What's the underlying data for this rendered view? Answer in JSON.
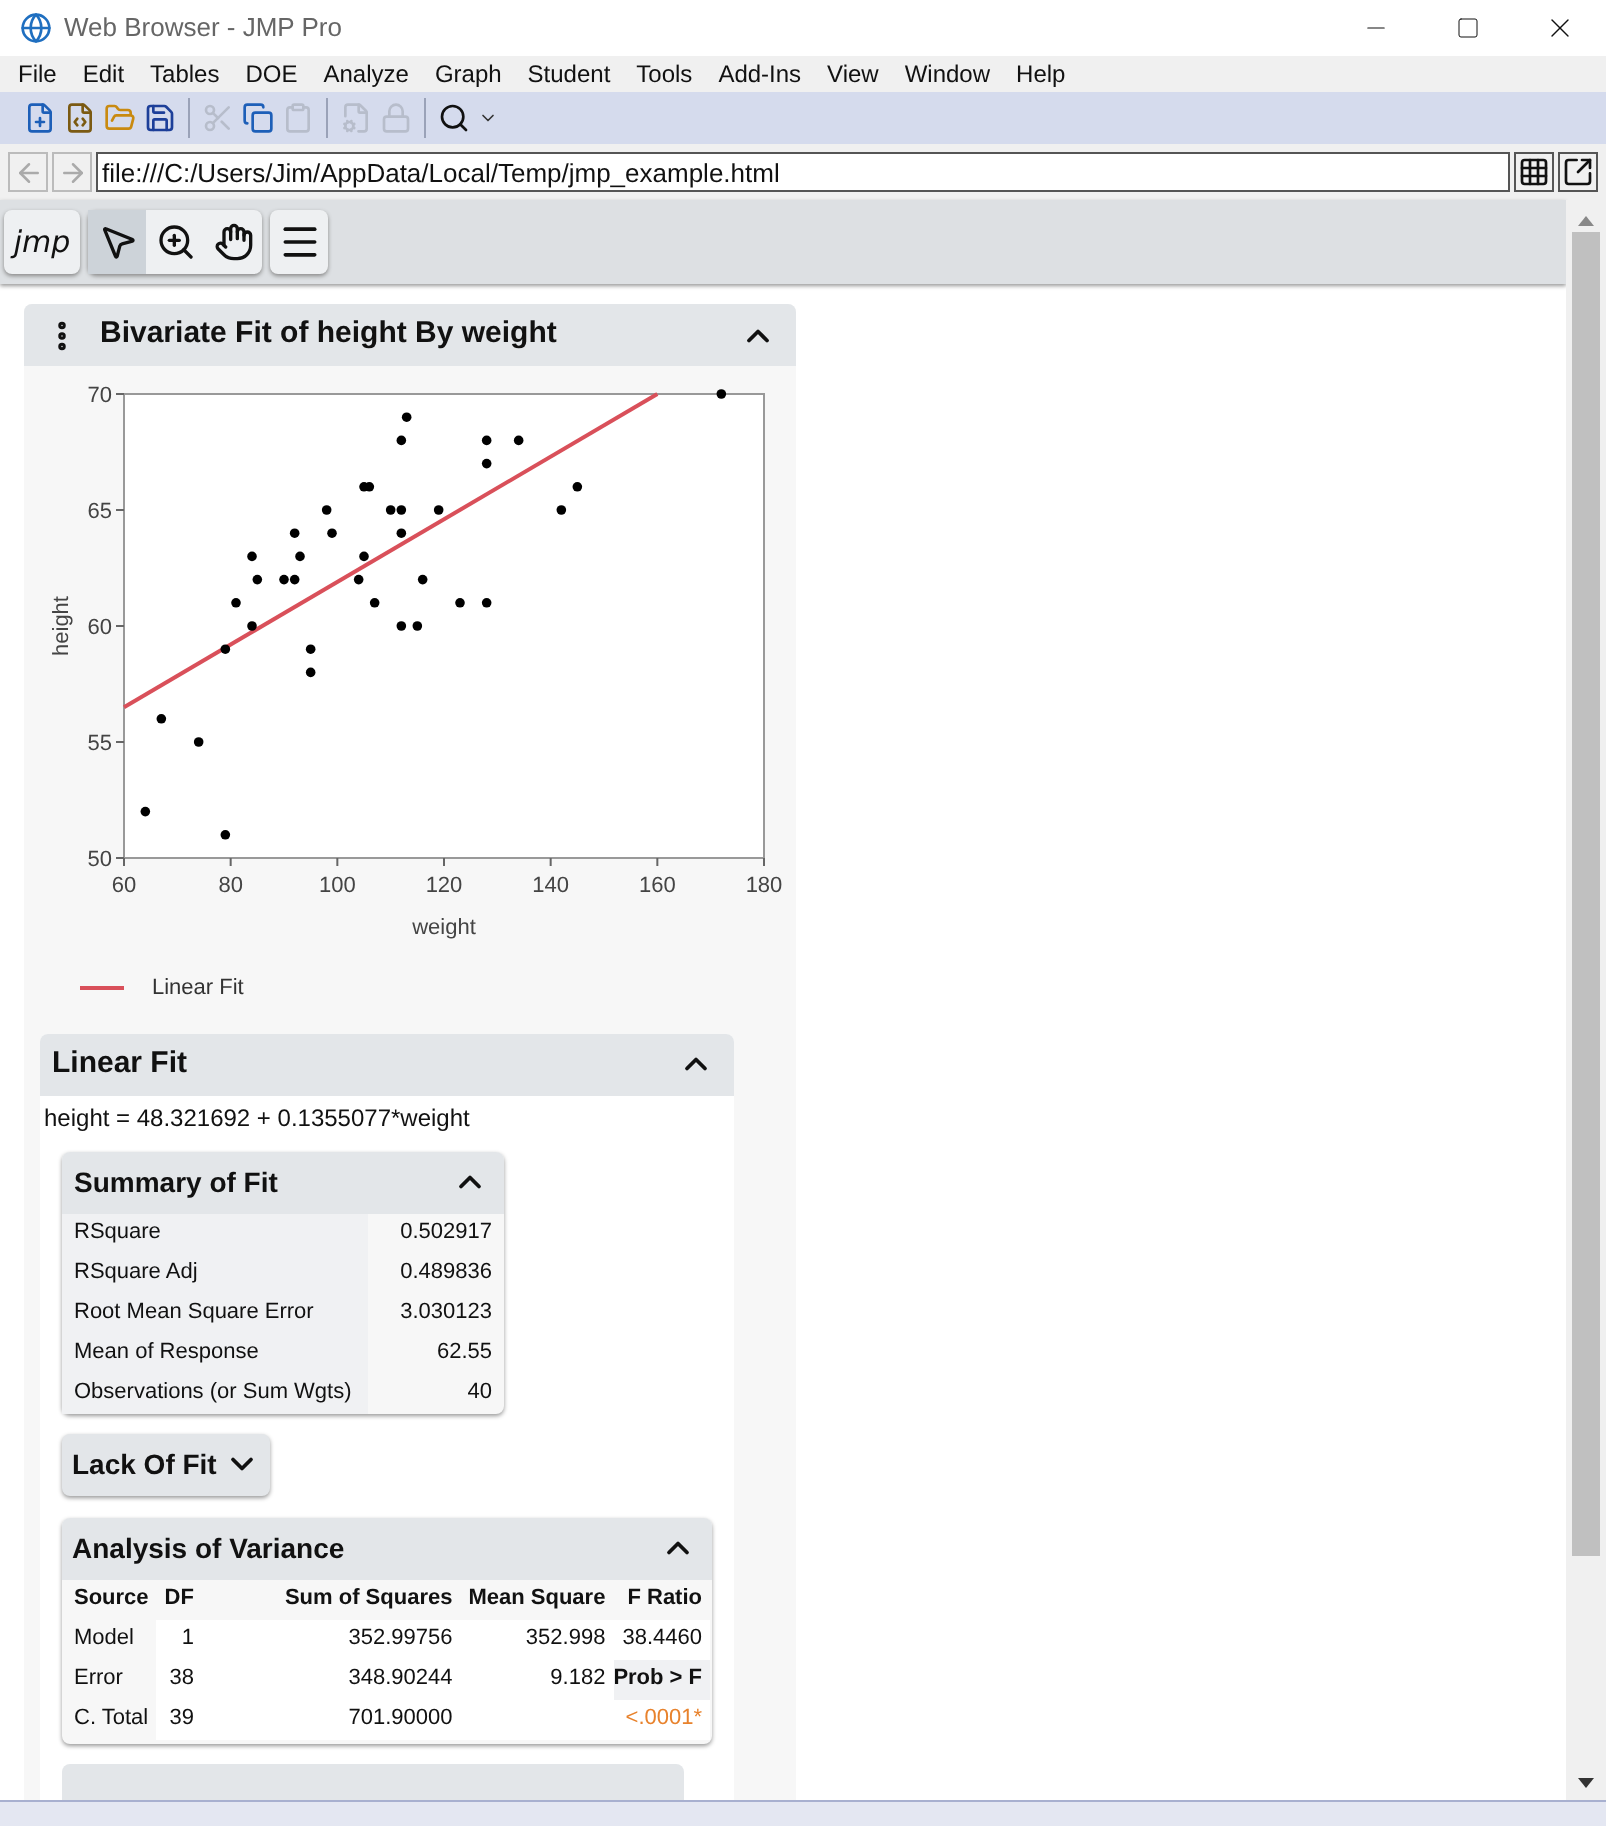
{
  "window": {
    "title": "Web Browser - JMP Pro"
  },
  "menu": [
    "File",
    "Edit",
    "Tables",
    "DOE",
    "Analyze",
    "Graph",
    "Student",
    "Tools",
    "Add-Ins",
    "View",
    "Window",
    "Help"
  ],
  "toolbar": [
    {
      "kind": "new-table",
      "disabled": false
    },
    {
      "kind": "new-script",
      "disabled": false
    },
    {
      "kind": "open",
      "disabled": false
    },
    {
      "kind": "save",
      "disabled": false
    },
    {
      "kind": "separator"
    },
    {
      "kind": "cut",
      "disabled": true
    },
    {
      "kind": "copy",
      "disabled": false
    },
    {
      "kind": "paste",
      "disabled": true
    },
    {
      "kind": "separator"
    },
    {
      "kind": "script",
      "disabled": true
    },
    {
      "kind": "lock",
      "disabled": true
    },
    {
      "kind": "separator"
    },
    {
      "kind": "search",
      "disabled": false
    },
    {
      "kind": "more",
      "disabled": false
    }
  ],
  "address": {
    "back_disabled": true,
    "forward_disabled": true,
    "value": "file:///C:/Users/Jim/AppData/Local/Temp/jmp_example.html"
  },
  "jmp_toolbar": {
    "logo": "jmp",
    "tools": [
      {
        "kind": "select",
        "selected": true
      },
      {
        "kind": "zoom",
        "selected": false
      },
      {
        "kind": "hand",
        "selected": false
      }
    ]
  },
  "report": {
    "title": "Bivariate Fit of height By weight",
    "expanded": true,
    "chart_data": {
      "type": "scatter",
      "xlabel": "weight",
      "ylabel": "height",
      "xlim": [
        60,
        180
      ],
      "ylim": [
        50,
        70
      ],
      "xticks": [
        60,
        80,
        100,
        120,
        140,
        160,
        180
      ],
      "yticks": [
        50,
        55,
        60,
        65,
        70
      ],
      "series": [
        {
          "type": "scatter",
          "color": "#000000",
          "x": [
            64,
            67,
            74,
            79,
            79,
            81,
            84,
            84,
            85,
            90,
            92,
            92,
            93,
            95,
            95,
            98,
            99,
            104,
            105,
            105,
            106,
            107,
            110,
            112,
            112,
            112,
            112,
            113,
            115,
            116,
            119,
            123,
            128,
            128,
            128,
            134,
            142,
            145,
            172
          ],
          "values": [
            52,
            56,
            55,
            51,
            59,
            61,
            63,
            60,
            62,
            62,
            62,
            64,
            63,
            59,
            58,
            65,
            64,
            62,
            63,
            66,
            66,
            61,
            65,
            65,
            64,
            60,
            68,
            69,
            60,
            62,
            65,
            61,
            68,
            67,
            61,
            68,
            65,
            66,
            70
          ]
        },
        {
          "type": "line",
          "name": "Linear Fit",
          "color": "#d9505a",
          "x": [
            60,
            160
          ],
          "values": [
            56.5,
            70.0
          ]
        }
      ]
    },
    "linear_fit": {
      "title": "Linear Fit",
      "expanded": true,
      "equation": "height = 48.321692 + 0.1355077*weight",
      "summary": {
        "title": "Summary of Fit",
        "expanded": true,
        "rows": [
          {
            "label": "RSquare",
            "value": "0.502917"
          },
          {
            "label": "RSquare Adj",
            "value": "0.489836"
          },
          {
            "label": "Root Mean Square Error",
            "value": "3.030123"
          },
          {
            "label": "Mean of Response",
            "value": "62.55"
          },
          {
            "label": "Observations (or Sum Wgts)",
            "value": "40"
          }
        ]
      },
      "lack_of_fit": {
        "title": "Lack Of Fit",
        "expanded": false
      },
      "anova": {
        "title": "Analysis of Variance",
        "expanded": true,
        "columns": [
          "Source",
          "DF",
          "Sum of Squares",
          "Mean Square",
          "F Ratio"
        ],
        "rows": [
          {
            "source": "Model",
            "df": "1",
            "ss": "352.99756",
            "ms": "352.998",
            "f": {
              "text": "38.4460",
              "kind": "value"
            }
          },
          {
            "source": "Error",
            "df": "38",
            "ss": "348.90244",
            "ms": "9.182",
            "f": {
              "text": "Prob > F",
              "kind": "header"
            }
          },
          {
            "source": "C. Total",
            "df": "39",
            "ss": "701.90000",
            "f": {
              "text": "<.0001*",
              "kind": "pvalue"
            }
          }
        ]
      }
    }
  }
}
